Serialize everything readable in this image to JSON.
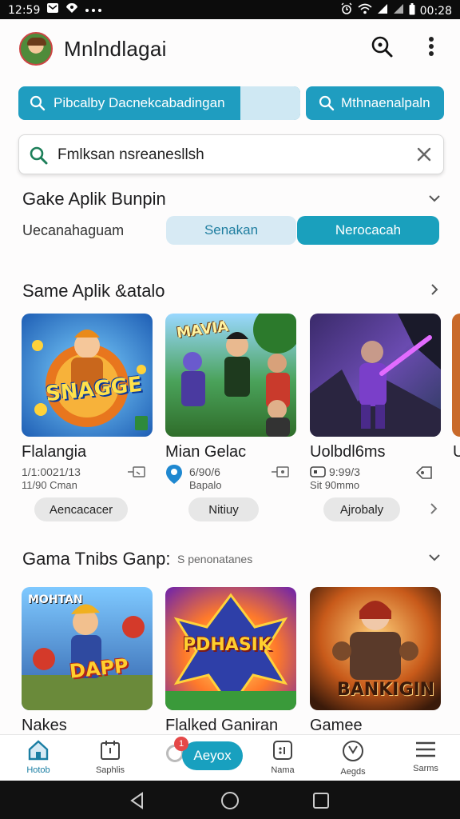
{
  "status_bar": {
    "time": "12:59",
    "left_icons": [
      "message-icon",
      "vpn-icon",
      "more-dots-icon"
    ],
    "right_icons": [
      "alarm-icon",
      "wifi-icon",
      "signal-icon",
      "signal-icon",
      "battery-icon"
    ],
    "right_time": "00:28"
  },
  "header": {
    "title": "Mnlndlagai"
  },
  "chips": {
    "primary": "Pibcalby Dacnekcabadingan",
    "secondary": "Mthnaenalpaln"
  },
  "search": {
    "value": "Fmlksan nsreanesllsh"
  },
  "section1": {
    "title": "Gake Aplik Bunpin",
    "filter_label": "Uecanahaguam",
    "seg_off": "Senakan",
    "seg_on": "Nerocacah"
  },
  "section2": {
    "title": "Same Aplik &atalo",
    "cards": [
      {
        "name": "Flalangia",
        "meta1": "1/1:0021/13",
        "meta2": "11/90 Cman",
        "pill": "Aencacacer",
        "art_text": "SNAGGE"
      },
      {
        "name": "Mian Gelac",
        "meta1": "6/90/6",
        "meta2": "Bapalo",
        "pill": "Nitiuy",
        "art_text": "MAVIA"
      },
      {
        "name": "Uolbdl6ms",
        "meta1": "9:99/3",
        "meta2": "Sit 90mmo",
        "pill": "Ajrobaly",
        "art_text": ""
      }
    ],
    "peek_name": "U"
  },
  "section3": {
    "title": "Gama Tnibs Ganp:",
    "subtitle": "S penonatanes",
    "cards": [
      {
        "name": "Nakes",
        "art_text": "DAPP",
        "art_top": "MOHTAN"
      },
      {
        "name": "Flalked Ganiran",
        "art_text": "PDHASIK"
      },
      {
        "name": "Gamee",
        "art_text": "BANKIGIN"
      }
    ]
  },
  "bottom_nav": {
    "items": [
      {
        "label": "Hotob",
        "icon": "home-icon"
      },
      {
        "label": "Saphlis",
        "icon": "calendar-icon"
      },
      {
        "label": "Nama",
        "icon": "timer-icon"
      },
      {
        "label": "Aegds",
        "icon": "clock-icon"
      },
      {
        "label": "Sarms",
        "icon": "menu-icon"
      }
    ],
    "center_label": "Aeyox",
    "badge": "1"
  },
  "colors": {
    "accent": "#1aa0bd",
    "accent_light": "#d7eaf4",
    "background": "#fdfcfc"
  }
}
